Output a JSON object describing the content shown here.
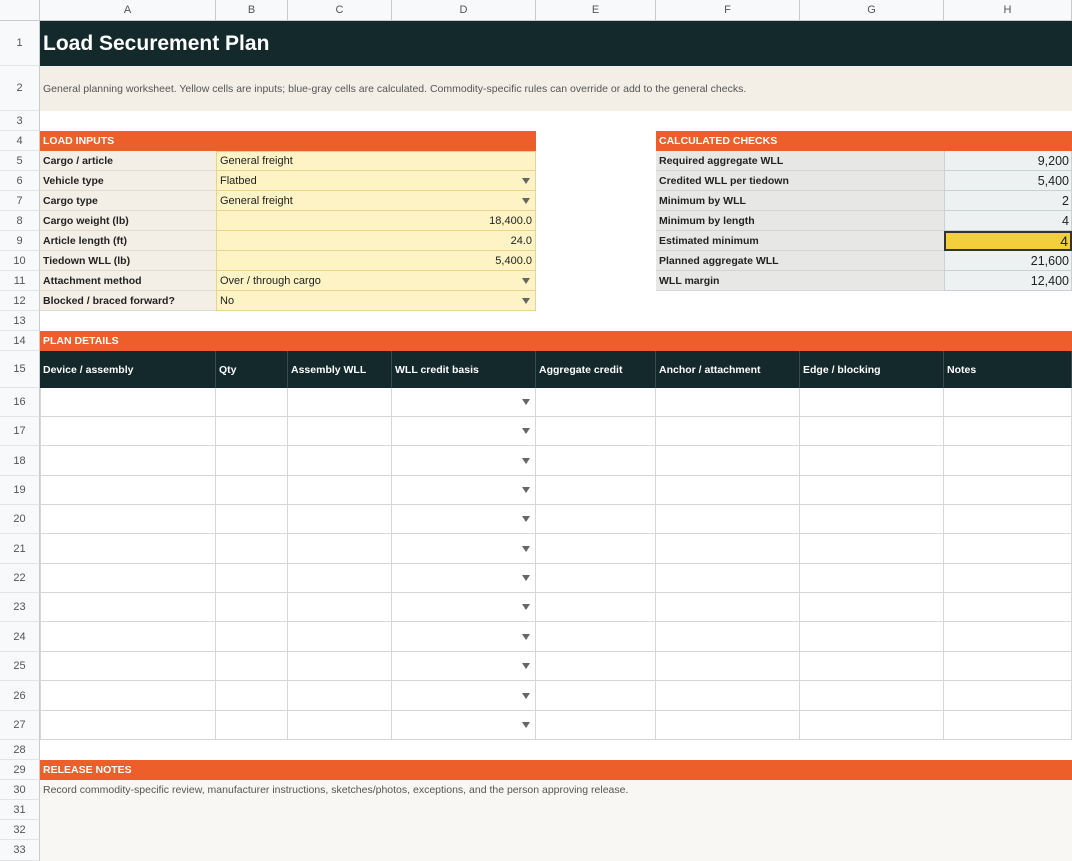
{
  "columns": [
    "A",
    "B",
    "C",
    "D",
    "E",
    "F",
    "G",
    "H"
  ],
  "rows": [
    "1",
    "2",
    "3",
    "4",
    "5",
    "6",
    "7",
    "8",
    "9",
    "10",
    "11",
    "12",
    "13",
    "14",
    "15",
    "16",
    "17",
    "18",
    "19",
    "20",
    "21",
    "22",
    "23",
    "24",
    "25",
    "26",
    "27",
    "28",
    "29",
    "30",
    "31",
    "32",
    "33"
  ],
  "title": "Load Securement Plan",
  "subtitle": "General planning worksheet. Yellow cells are inputs; blue-gray cells are calculated. Commodity-specific rules can override or add to the general checks.",
  "load_inputs": {
    "header": "LOAD INPUTS",
    "fields": [
      {
        "label": "Cargo / article",
        "value": "General freight",
        "dropdown": false
      },
      {
        "label": "Vehicle type",
        "value": "Flatbed",
        "dropdown": true
      },
      {
        "label": "Cargo type",
        "value": "General freight",
        "dropdown": true
      },
      {
        "label": "Cargo weight (lb)",
        "value": "18,400.0",
        "dropdown": false
      },
      {
        "label": "Article length (ft)",
        "value": "24.0",
        "dropdown": false
      },
      {
        "label": "Tiedown WLL (lb)",
        "value": "5,400.0",
        "dropdown": false
      },
      {
        "label": "Attachment method",
        "value": "Over / through cargo",
        "dropdown": true
      },
      {
        "label": "Blocked / braced forward?",
        "value": "No",
        "dropdown": true
      }
    ]
  },
  "calculated_checks": {
    "header": "CALCULATED CHECKS",
    "items": [
      {
        "label": "Required aggregate WLL",
        "value": "9,200"
      },
      {
        "label": "Credited WLL per tiedown",
        "value": "5,400"
      },
      {
        "label": "Minimum by WLL",
        "value": "2"
      },
      {
        "label": "Minimum by length",
        "value": "4"
      },
      {
        "label": "Estimated minimum",
        "value": "4"
      },
      {
        "label": "Planned aggregate WLL",
        "value": "21,600"
      },
      {
        "label": "WLL margin",
        "value": "12,400"
      }
    ]
  },
  "plan_details": {
    "header": "PLAN DETAILS",
    "columns": [
      "Device / assembly",
      "Qty",
      "Assembly WLL",
      "WLL credit basis",
      "Aggregate credit",
      "Anchor / attachment",
      "Edge / blocking",
      "Notes"
    ],
    "row_count": 12
  },
  "release_notes": {
    "header": "RELEASE NOTES",
    "text": "Record commodity-specific review, manufacturer instructions, sketches/photos, exceptions, and the person approving release."
  },
  "colors": {
    "title_bg": "#14292c",
    "section_orange": "#ec5f2a",
    "input_yellow": "#fdf3c4",
    "calc_bluegray": "#edf1f2",
    "highlight": "#f2cf3b"
  }
}
